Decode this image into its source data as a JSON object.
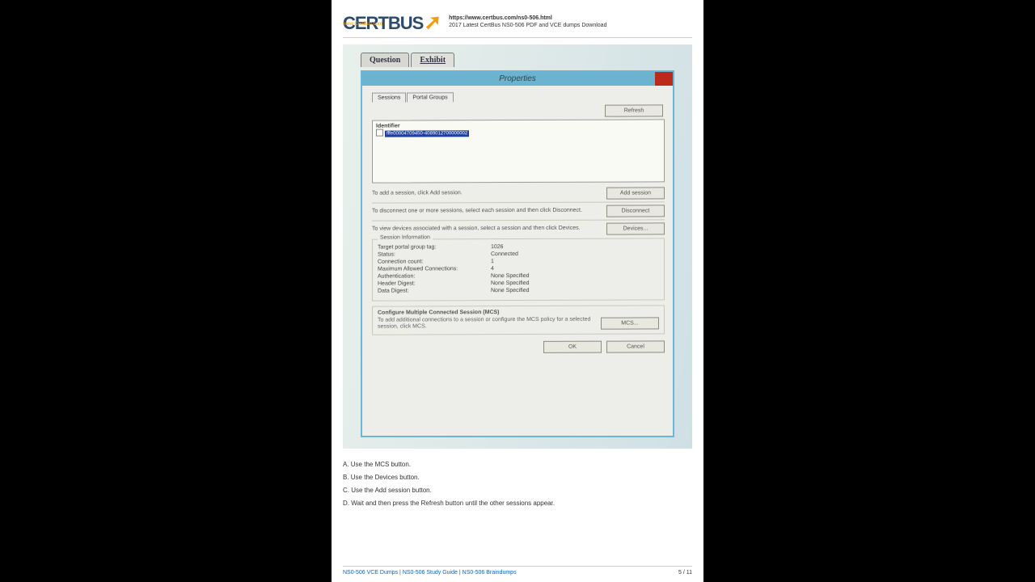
{
  "header": {
    "logo_top": "www.CertBus.com",
    "logo_a": "CERT",
    "logo_b": "BUS",
    "url": "https://www.certbus.com/ns0-506.html",
    "subtitle": "2017 Latest CertBus NS0-506 PDF and VCE dumps Download"
  },
  "exhibit": {
    "tabs": {
      "question": "Question",
      "exhibit": "Exhibit"
    },
    "dialog_title": "Properties",
    "subtabs": {
      "sessions": "Sessions",
      "portal_groups": "Portal Groups"
    },
    "btn_refresh": "Refresh",
    "identifier_header": "Identifier",
    "identifier_row": "fffe00004709450-4089012700000002",
    "instr_add": "To add a session, click Add session.",
    "btn_add": "Add session",
    "instr_disc": "To disconnect one or more sessions, select each session and then click Disconnect.",
    "btn_disc": "Disconnect",
    "instr_dev": "To view devices associated with a session, select a session and then click Devices.",
    "btn_dev": "Devices...",
    "session_info_legend": "Session Information",
    "kv": [
      {
        "k": "Target portal group tag:",
        "v": "1026"
      },
      {
        "k": "Status:",
        "v": "Connected"
      },
      {
        "k": "Connection count:",
        "v": "1"
      },
      {
        "k": "Maximum Allowed Connections:",
        "v": "4"
      },
      {
        "k": "Authentication:",
        "v": "None Specified"
      },
      {
        "k": "Header Digest:",
        "v": "None Specified"
      },
      {
        "k": "Data Digest:",
        "v": "None Specified"
      }
    ],
    "mcs_title": "Configure Multiple Connected Session (MCS)",
    "mcs_text": "To add additional connections to a session or configure the MCS policy for a selected session, click MCS.",
    "btn_mcs": "MCS...",
    "btn_ok": "OK",
    "btn_cancel": "Cancel"
  },
  "answers": {
    "a": "A. Use the MCS button.",
    "b": "B. Use the Devices button.",
    "c": "C. Use the Add session button.",
    "d": "D. Wait and then press the Refresh button until the other sessions appear."
  },
  "footer": {
    "link1": "NS0-506 VCE Dumps",
    "link2": "NS0-506 Study Guide",
    "link3": "NS0-506 Braindumps",
    "page": "5 / 11"
  }
}
